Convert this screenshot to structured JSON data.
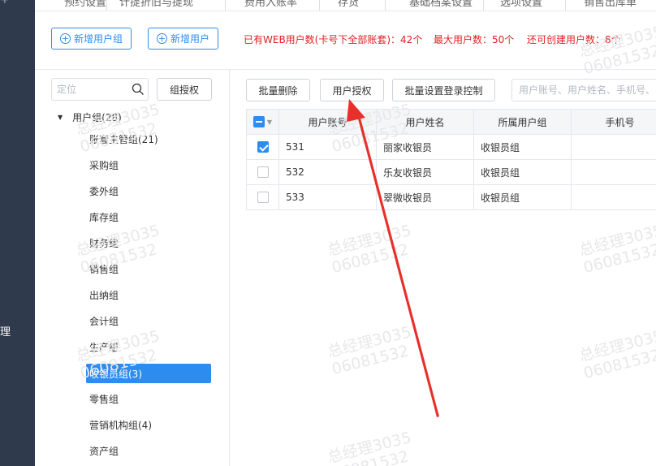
{
  "top_tabs": [
    "预约设置",
    "计提折旧与提现",
    "费用入账率",
    "存货",
    "基础档案设置",
    "选项设置",
    "销售出库单"
  ],
  "action_bar": {
    "add_group_label": "新增用户组",
    "add_user_label": "新增用户",
    "web_user_info": "已有WEB用户数(卡号下全部账套)：42个",
    "max_users_info": "最大用户数：50个",
    "remaining_info": "还可创建用户数：8个"
  },
  "left_panel": {
    "locate_placeholder": "定位",
    "group_auth_label": "组授权",
    "root_label": "用户组(28)",
    "groups": [
      {
        "label": "账套主管组(21)"
      },
      {
        "label": "采购组"
      },
      {
        "label": "委外组"
      },
      {
        "label": "库存组"
      },
      {
        "label": "财务组"
      },
      {
        "label": "销售组"
      },
      {
        "label": "出纳组"
      },
      {
        "label": "会计组"
      },
      {
        "label": "生产组"
      },
      {
        "label": "收银员组(3)"
      },
      {
        "label": "零售组"
      },
      {
        "label": "营销机构组(4)"
      },
      {
        "label": "资产组"
      }
    ],
    "active_index": 9
  },
  "right_panel": {
    "batch_delete_label": "批量删除",
    "user_auth_label": "用户授权",
    "batch_login_label": "批量设置登录控制",
    "search_placeholder": "用户账号、用户姓名、手机号、邮箱",
    "columns": [
      "用户账号",
      "用户姓名",
      "所属用户组",
      "手机号"
    ],
    "rows": [
      {
        "checked": true,
        "account": "531",
        "name": "丽家收银员",
        "group": "收银员组",
        "phone": ""
      },
      {
        "checked": false,
        "account": "532",
        "name": "乐友收银员",
        "group": "收银员组",
        "phone": ""
      },
      {
        "checked": false,
        "account": "533",
        "name": "翠微收银员",
        "group": "收银员组",
        "phone": ""
      }
    ]
  },
  "nav": {
    "plus_glyph": "+",
    "visible_char": "理"
  },
  "watermark": {
    "line1": "总经理3035",
    "line2": "06081532"
  },
  "colors": {
    "accent": "#2d8cf0",
    "warning_text": "#e02020",
    "nav_bg": "#2f3b4c",
    "arrow": "#e8302a"
  }
}
